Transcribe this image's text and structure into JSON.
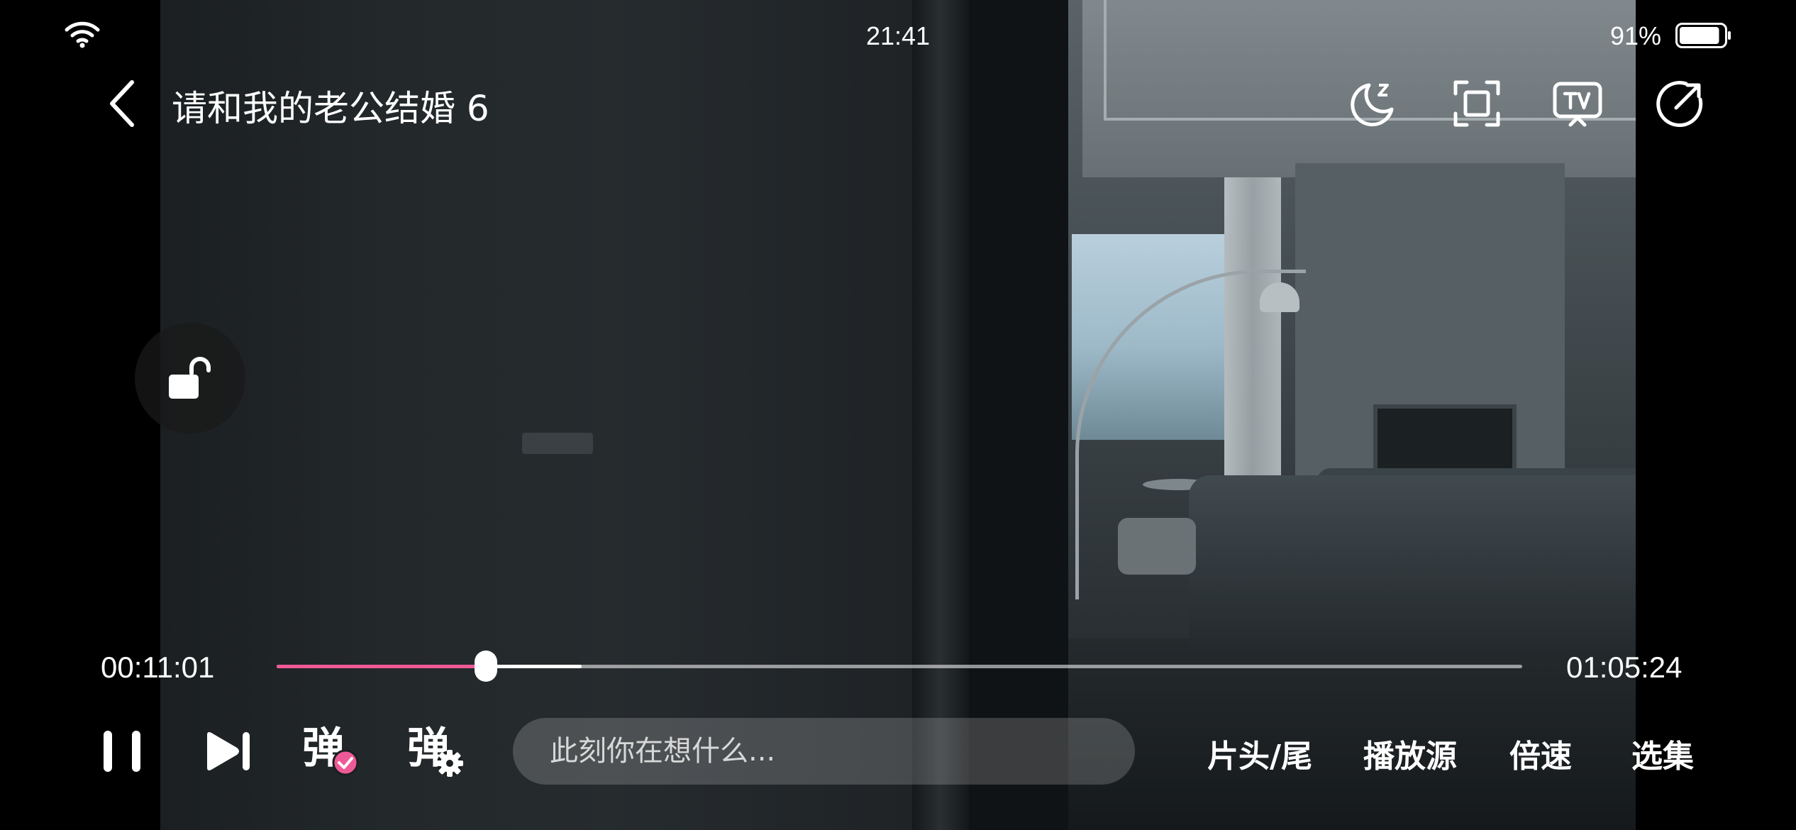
{
  "status_bar": {
    "time": "21:41",
    "battery_percent": "91%",
    "battery_level": 0.91
  },
  "header": {
    "title": "请和我的老公结婚 6",
    "icons": [
      "back-icon",
      "sleep-timer-icon",
      "fullscreen-crop-icon",
      "tv-cast-icon",
      "share-icon"
    ]
  },
  "lock": {
    "icon": "unlock-icon"
  },
  "progress": {
    "current_time": "00:11:01",
    "total_time": "01:05:24",
    "played_fraction": 0.168,
    "buffered_fraction": 0.245,
    "played_color": "#ee5a97"
  },
  "controls": {
    "icons": [
      "pause-icon",
      "next-episode-icon",
      "danmaku-toggle-icon",
      "danmaku-settings-icon"
    ],
    "danmaku_char": "弹",
    "comment_placeholder": "此刻你在想什么...",
    "intro_outro_label": "片头/尾",
    "source_label": "播放源",
    "speed_label": "倍速",
    "episodes_label": "选集"
  }
}
